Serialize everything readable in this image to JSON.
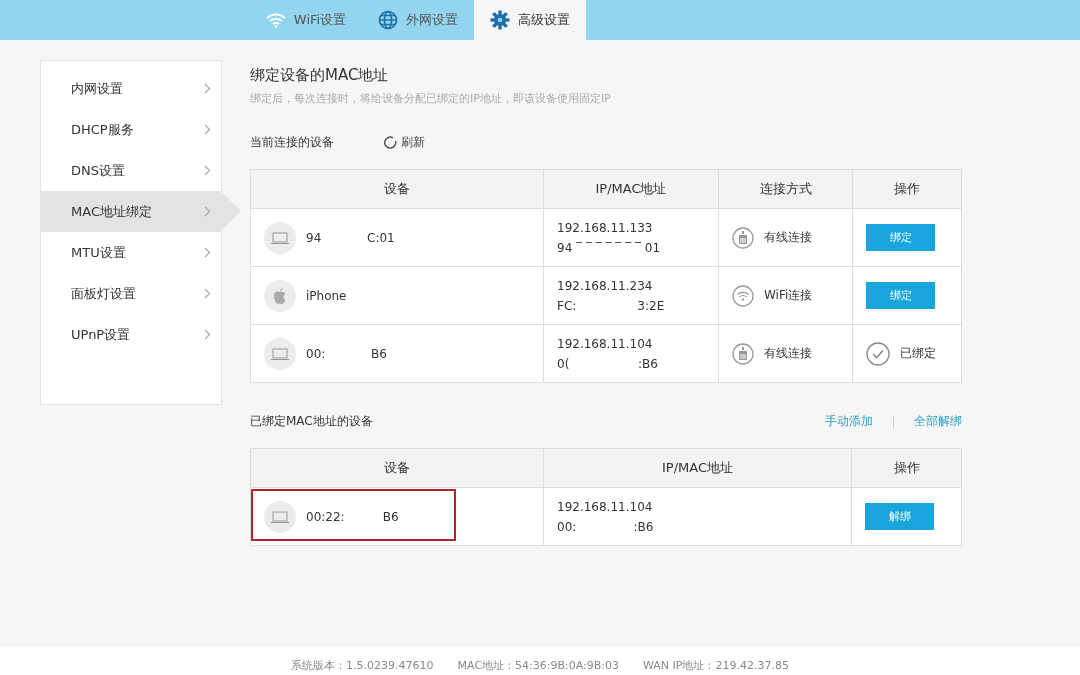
{
  "top_tabs": [
    {
      "label": "WiFi设置",
      "kind": "wifi",
      "selected": false
    },
    {
      "label": "外网设置",
      "kind": "globe",
      "selected": false
    },
    {
      "label": "高级设置",
      "kind": "gear",
      "selected": true
    }
  ],
  "sidebar": {
    "items": [
      {
        "label": "内网设置",
        "selected": false
      },
      {
        "label": "DHCP服务",
        "selected": false
      },
      {
        "label": "DNS设置",
        "selected": false
      },
      {
        "label": "MAC地址绑定",
        "selected": true
      },
      {
        "label": "MTU设置",
        "selected": false
      },
      {
        "label": "面板灯设置",
        "selected": false
      },
      {
        "label": "UPnP设置",
        "selected": false
      }
    ]
  },
  "title": "绑定设备的MAC地址",
  "subtitle": "绑定后，每次连接时，将给设备分配已绑定的IP地址，即该设备使用固定IP",
  "current": {
    "heading": "当前连接的设备",
    "refresh": "刷新",
    "columns": [
      "设备",
      "IP/MAC地址",
      "连接方式",
      "操作"
    ],
    "rows": [
      {
        "kind": "laptop",
        "device": "94            C:01",
        "ip": "192.168.11.133",
        "mac": "94 ‾ ‾ ‾ ‾ ‾ ‾ ‾ 01",
        "connection": {
          "kind": "wired",
          "label": "有线连接"
        },
        "bound": false,
        "action": "绑定"
      },
      {
        "kind": "apple",
        "device": "iPhone",
        "ip": "192.168.11.234",
        "mac": "FC:                3:2E",
        "connection": {
          "kind": "wifi",
          "label": "WiFi连接"
        },
        "bound": false,
        "action": "绑定"
      },
      {
        "kind": "laptop",
        "device": "00:            B6",
        "ip": "192.168.11.104",
        "mac": "0(                  :B6",
        "connection": {
          "kind": "wired",
          "label": "有线连接"
        },
        "bound": true,
        "action": "已绑定"
      }
    ]
  },
  "bound": {
    "heading": "已绑定MAC地址的设备",
    "add": "手动添加",
    "unbind_all": "全部解绑",
    "columns": [
      "设备",
      "IP/MAC地址",
      "操作"
    ],
    "rows": [
      {
        "kind": "laptop",
        "device": "00:22:          B6",
        "ip": "192.168.11.104",
        "mac": "00:               :B6",
        "highlighted": true,
        "action": "解绑"
      }
    ]
  },
  "footer": [
    "系统版本：1.5.0239.47610",
    "MAC地址：54:36:9B:0A:9B:03",
    "WAN IP地址：219.42.37.85"
  ]
}
